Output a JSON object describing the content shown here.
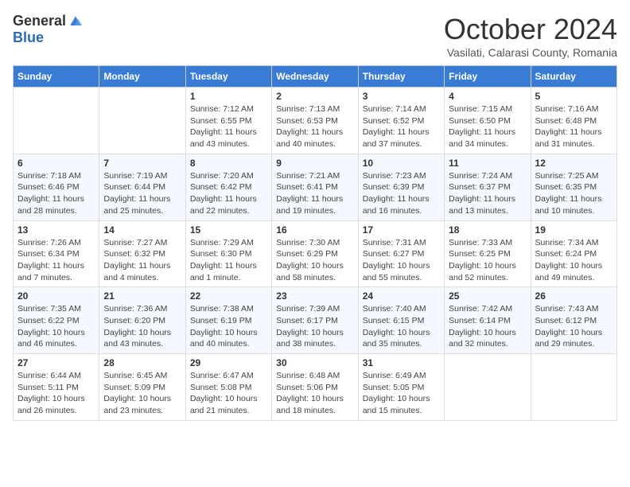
{
  "logo": {
    "general": "General",
    "blue": "Blue"
  },
  "title": "October 2024",
  "location": "Vasilati, Calarasi County, Romania",
  "days_of_week": [
    "Sunday",
    "Monday",
    "Tuesday",
    "Wednesday",
    "Thursday",
    "Friday",
    "Saturday"
  ],
  "weeks": [
    [
      {
        "day": "",
        "info": ""
      },
      {
        "day": "",
        "info": ""
      },
      {
        "day": "1",
        "info": "Sunrise: 7:12 AM\nSunset: 6:55 PM\nDaylight: 11 hours and 43 minutes."
      },
      {
        "day": "2",
        "info": "Sunrise: 7:13 AM\nSunset: 6:53 PM\nDaylight: 11 hours and 40 minutes."
      },
      {
        "day": "3",
        "info": "Sunrise: 7:14 AM\nSunset: 6:52 PM\nDaylight: 11 hours and 37 minutes."
      },
      {
        "day": "4",
        "info": "Sunrise: 7:15 AM\nSunset: 6:50 PM\nDaylight: 11 hours and 34 minutes."
      },
      {
        "day": "5",
        "info": "Sunrise: 7:16 AM\nSunset: 6:48 PM\nDaylight: 11 hours and 31 minutes."
      }
    ],
    [
      {
        "day": "6",
        "info": "Sunrise: 7:18 AM\nSunset: 6:46 PM\nDaylight: 11 hours and 28 minutes."
      },
      {
        "day": "7",
        "info": "Sunrise: 7:19 AM\nSunset: 6:44 PM\nDaylight: 11 hours and 25 minutes."
      },
      {
        "day": "8",
        "info": "Sunrise: 7:20 AM\nSunset: 6:42 PM\nDaylight: 11 hours and 22 minutes."
      },
      {
        "day": "9",
        "info": "Sunrise: 7:21 AM\nSunset: 6:41 PM\nDaylight: 11 hours and 19 minutes."
      },
      {
        "day": "10",
        "info": "Sunrise: 7:23 AM\nSunset: 6:39 PM\nDaylight: 11 hours and 16 minutes."
      },
      {
        "day": "11",
        "info": "Sunrise: 7:24 AM\nSunset: 6:37 PM\nDaylight: 11 hours and 13 minutes."
      },
      {
        "day": "12",
        "info": "Sunrise: 7:25 AM\nSunset: 6:35 PM\nDaylight: 11 hours and 10 minutes."
      }
    ],
    [
      {
        "day": "13",
        "info": "Sunrise: 7:26 AM\nSunset: 6:34 PM\nDaylight: 11 hours and 7 minutes."
      },
      {
        "day": "14",
        "info": "Sunrise: 7:27 AM\nSunset: 6:32 PM\nDaylight: 11 hours and 4 minutes."
      },
      {
        "day": "15",
        "info": "Sunrise: 7:29 AM\nSunset: 6:30 PM\nDaylight: 11 hours and 1 minute."
      },
      {
        "day": "16",
        "info": "Sunrise: 7:30 AM\nSunset: 6:29 PM\nDaylight: 10 hours and 58 minutes."
      },
      {
        "day": "17",
        "info": "Sunrise: 7:31 AM\nSunset: 6:27 PM\nDaylight: 10 hours and 55 minutes."
      },
      {
        "day": "18",
        "info": "Sunrise: 7:33 AM\nSunset: 6:25 PM\nDaylight: 10 hours and 52 minutes."
      },
      {
        "day": "19",
        "info": "Sunrise: 7:34 AM\nSunset: 6:24 PM\nDaylight: 10 hours and 49 minutes."
      }
    ],
    [
      {
        "day": "20",
        "info": "Sunrise: 7:35 AM\nSunset: 6:22 PM\nDaylight: 10 hours and 46 minutes."
      },
      {
        "day": "21",
        "info": "Sunrise: 7:36 AM\nSunset: 6:20 PM\nDaylight: 10 hours and 43 minutes."
      },
      {
        "day": "22",
        "info": "Sunrise: 7:38 AM\nSunset: 6:19 PM\nDaylight: 10 hours and 40 minutes."
      },
      {
        "day": "23",
        "info": "Sunrise: 7:39 AM\nSunset: 6:17 PM\nDaylight: 10 hours and 38 minutes."
      },
      {
        "day": "24",
        "info": "Sunrise: 7:40 AM\nSunset: 6:15 PM\nDaylight: 10 hours and 35 minutes."
      },
      {
        "day": "25",
        "info": "Sunrise: 7:42 AM\nSunset: 6:14 PM\nDaylight: 10 hours and 32 minutes."
      },
      {
        "day": "26",
        "info": "Sunrise: 7:43 AM\nSunset: 6:12 PM\nDaylight: 10 hours and 29 minutes."
      }
    ],
    [
      {
        "day": "27",
        "info": "Sunrise: 6:44 AM\nSunset: 5:11 PM\nDaylight: 10 hours and 26 minutes."
      },
      {
        "day": "28",
        "info": "Sunrise: 6:45 AM\nSunset: 5:09 PM\nDaylight: 10 hours and 23 minutes."
      },
      {
        "day": "29",
        "info": "Sunrise: 6:47 AM\nSunset: 5:08 PM\nDaylight: 10 hours and 21 minutes."
      },
      {
        "day": "30",
        "info": "Sunrise: 6:48 AM\nSunset: 5:06 PM\nDaylight: 10 hours and 18 minutes."
      },
      {
        "day": "31",
        "info": "Sunrise: 6:49 AM\nSunset: 5:05 PM\nDaylight: 10 hours and 15 minutes."
      },
      {
        "day": "",
        "info": ""
      },
      {
        "day": "",
        "info": ""
      }
    ]
  ]
}
